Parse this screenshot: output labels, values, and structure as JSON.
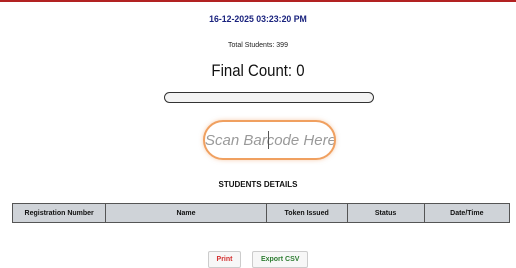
{
  "header": {
    "datetime": "16-12-2025 03:23:20 PM",
    "total_students": "Total Students: 399",
    "final_count": "Final Count: 0"
  },
  "progress": {
    "value_percent": 0
  },
  "scan": {
    "placeholder": "Scan Barcode Here..."
  },
  "details": {
    "heading": "STUDENTS DETAILS",
    "columns": [
      "Registration Number",
      "Name",
      "Token Issued",
      "Status",
      "Date/Time"
    ]
  },
  "actions": {
    "print_label": "Print",
    "export_label": "Export CSV"
  },
  "colors": {
    "datetime": "#1a237e",
    "input_border": "#f0a060",
    "print_text": "#d32f2f",
    "export_text": "#2e7d32",
    "header_row": "#cfd3d8"
  }
}
